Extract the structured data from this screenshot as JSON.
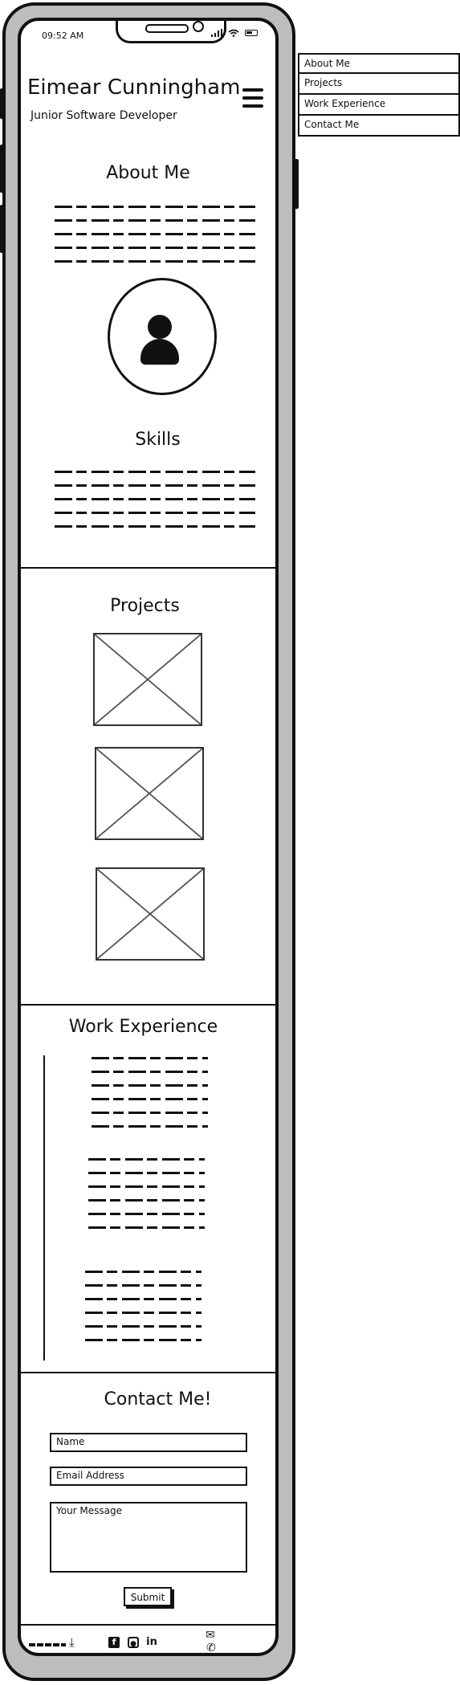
{
  "status_bar": {
    "time": "09:52 AM",
    "signal_icon": "signal-icon",
    "wifi_icon": "wifi-icon",
    "battery_icon": "battery-icon"
  },
  "header": {
    "name": "Eimear Cunningham",
    "role": "Junior Software Developer",
    "menu_icon": "hamburger-icon"
  },
  "nav_menu": {
    "items": [
      "About Me",
      "Projects",
      "Work Experience",
      "Contact Me"
    ]
  },
  "about": {
    "title": "About Me",
    "avatar_icon": "user-icon"
  },
  "skills": {
    "title": "Skills"
  },
  "projects": {
    "title": "Projects",
    "image_icon": "image-placeholder-icon"
  },
  "work": {
    "title": "Work Experience"
  },
  "contact": {
    "title": "Contact Me!",
    "name_placeholder": "Name",
    "email_placeholder": "Email Address",
    "message_placeholder": "Your Message",
    "submit_label": "Submit"
  },
  "footer": {
    "icons": [
      "logo-scribble",
      "download-icon",
      "facebook-icon",
      "github-icon",
      "linkedin-icon",
      "mail-icon",
      "phone-icon"
    ],
    "linkedin_glyph": "in"
  },
  "colors": {
    "frame": "#bdbdbd",
    "ink": "#111111",
    "screen": "#ffffff"
  }
}
